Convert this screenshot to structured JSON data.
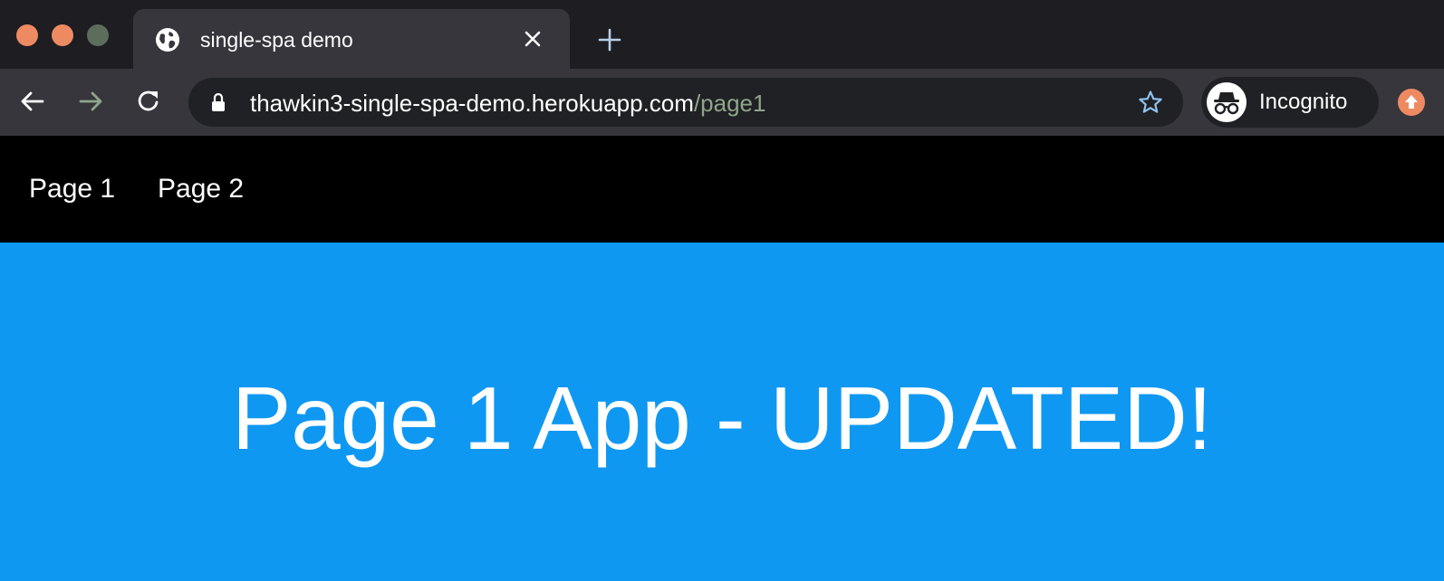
{
  "browser": {
    "tab": {
      "title": "single-spa demo",
      "favicon": "globe-icon"
    },
    "new_tab_icon": "plus-icon",
    "toolbar": {
      "url_host": "thawkin3-single-spa-demo.herokuapp.com",
      "url_path": "/page1",
      "profile_label": "Incognito"
    },
    "colors": {
      "tab_strip": "#1e1e22",
      "toolbar": "#36363c",
      "omnibox": "#202124",
      "traffic_light": "#ee8a62",
      "url_path": "#8fa58b"
    }
  },
  "page": {
    "nav": {
      "links": [
        "Page 1",
        "Page 2"
      ]
    },
    "headline": "Page 1 App - UPDATED!",
    "colors": {
      "navbar": "#000000",
      "content_background": "#0f98f2",
      "text": "#ffffff"
    }
  }
}
